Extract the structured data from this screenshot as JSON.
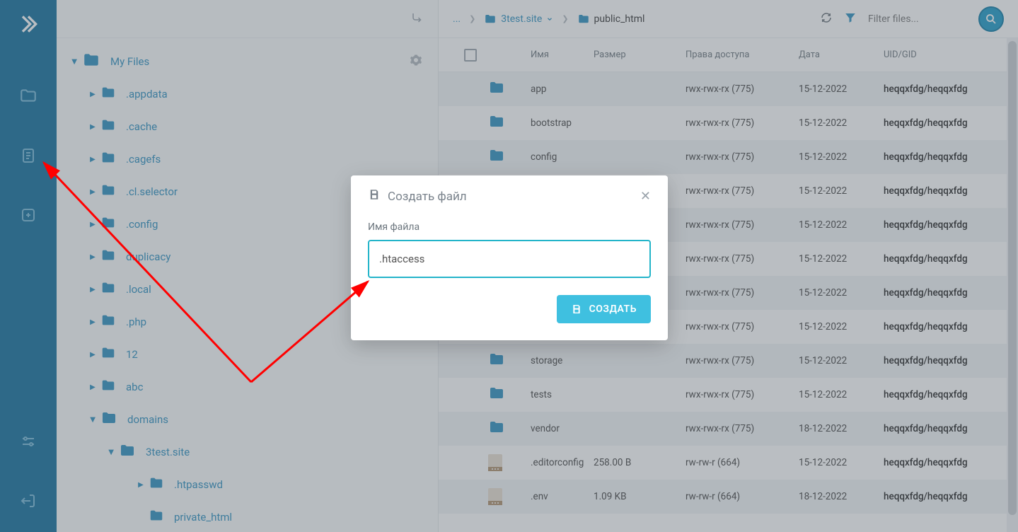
{
  "tree": {
    "root": "My Files",
    "items": [
      ".appdata",
      ".cache",
      ".cagefs",
      ".cl.selector",
      ".config",
      "duplicacy",
      ".local",
      ".php",
      "12",
      "abc"
    ],
    "domains": "domains",
    "site": "3test.site",
    "htpasswd": ".htpasswd",
    "private_html": "private_html"
  },
  "breadcrumb": {
    "dots": "...",
    "site": "3test.site",
    "current": "public_html",
    "filter_placeholder": "Filter files..."
  },
  "columns": {
    "name": "Имя",
    "size": "Размер",
    "perm": "Права доступа",
    "date": "Дата",
    "uid": "UID/GID"
  },
  "rows": [
    {
      "type": "dir",
      "name": "app",
      "size": "",
      "perm": "rwx-rwx-rx (775)",
      "date": "15-12-2022",
      "uid": "heqqxfdg/heqqxfdg"
    },
    {
      "type": "dir",
      "name": "bootstrap",
      "size": "",
      "perm": "rwx-rwx-rx (775)",
      "date": "15-12-2022",
      "uid": "heqqxfdg/heqqxfdg"
    },
    {
      "type": "dir",
      "name": "config",
      "size": "",
      "perm": "rwx-rwx-rx (775)",
      "date": "15-12-2022",
      "uid": "heqqxfdg/heqqxfdg"
    },
    {
      "type": "dir",
      "name": "",
      "size": "",
      "perm": "rwx-rwx-rx (775)",
      "date": "15-12-2022",
      "uid": "heqqxfdg/heqqxfdg"
    },
    {
      "type": "dir",
      "name": "",
      "size": "",
      "perm": "rwx-rwx-rx (775)",
      "date": "15-12-2022",
      "uid": "heqqxfdg/heqqxfdg"
    },
    {
      "type": "dir",
      "name": "",
      "size": "",
      "perm": "rwx-rwx-rx (775)",
      "date": "15-12-2022",
      "uid": "heqqxfdg/heqqxfdg"
    },
    {
      "type": "dir",
      "name": "",
      "size": "",
      "perm": "rwx-rwx-rx (775)",
      "date": "15-12-2022",
      "uid": "heqqxfdg/heqqxfdg"
    },
    {
      "type": "dir",
      "name": "",
      "size": "",
      "perm": "rwx-rwx-rx (775)",
      "date": "15-12-2022",
      "uid": "heqqxfdg/heqqxfdg"
    },
    {
      "type": "dir",
      "name": "storage",
      "size": "",
      "perm": "rwx-rwx-rx (775)",
      "date": "15-12-2022",
      "uid": "heqqxfdg/heqqxfdg"
    },
    {
      "type": "dir",
      "name": "tests",
      "size": "",
      "perm": "rwx-rwx-rx (775)",
      "date": "15-12-2022",
      "uid": "heqqxfdg/heqqxfdg"
    },
    {
      "type": "dir",
      "name": "vendor",
      "size": "",
      "perm": "rwx-rwx-rx (775)",
      "date": "18-12-2022",
      "uid": "heqqxfdg/heqqxfdg"
    },
    {
      "type": "file",
      "name": ".editorconfig",
      "size": "258.00 B",
      "perm": "rw-rw-r (664)",
      "date": "15-12-2022",
      "uid": "heqqxfdg/heqqxfdg"
    },
    {
      "type": "file",
      "name": ".env",
      "size": "1.09 KB",
      "perm": "rw-rw-r (664)",
      "date": "18-12-2022",
      "uid": "heqqxfdg/heqqxfdg"
    }
  ],
  "dialog": {
    "title": "Создать файл",
    "label": "Имя файла",
    "value": ".htaccess",
    "submit": "СОЗДАТЬ"
  }
}
